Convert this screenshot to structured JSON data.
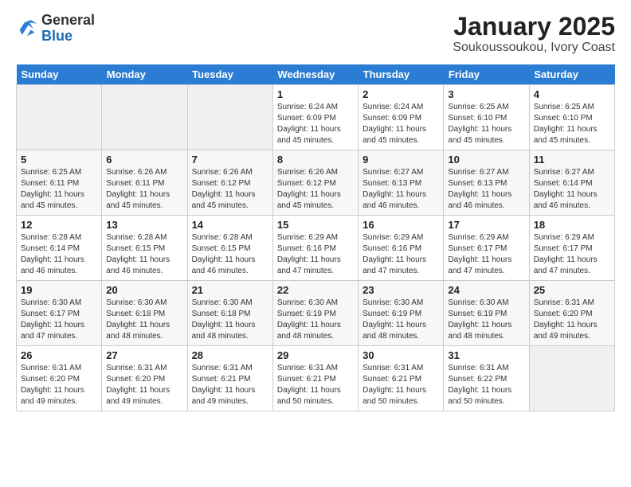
{
  "header": {
    "logo_general": "General",
    "logo_blue": "Blue",
    "title": "January 2025",
    "subtitle": "Soukoussoukou, Ivory Coast"
  },
  "columns": [
    "Sunday",
    "Monday",
    "Tuesday",
    "Wednesday",
    "Thursday",
    "Friday",
    "Saturday"
  ],
  "weeks": [
    [
      {
        "day": "",
        "sunrise": "",
        "sunset": "",
        "daylight": ""
      },
      {
        "day": "",
        "sunrise": "",
        "sunset": "",
        "daylight": ""
      },
      {
        "day": "",
        "sunrise": "",
        "sunset": "",
        "daylight": ""
      },
      {
        "day": "1",
        "sunrise": "Sunrise: 6:24 AM",
        "sunset": "Sunset: 6:09 PM",
        "daylight": "Daylight: 11 hours and 45 minutes."
      },
      {
        "day": "2",
        "sunrise": "Sunrise: 6:24 AM",
        "sunset": "Sunset: 6:09 PM",
        "daylight": "Daylight: 11 hours and 45 minutes."
      },
      {
        "day": "3",
        "sunrise": "Sunrise: 6:25 AM",
        "sunset": "Sunset: 6:10 PM",
        "daylight": "Daylight: 11 hours and 45 minutes."
      },
      {
        "day": "4",
        "sunrise": "Sunrise: 6:25 AM",
        "sunset": "Sunset: 6:10 PM",
        "daylight": "Daylight: 11 hours and 45 minutes."
      }
    ],
    [
      {
        "day": "5",
        "sunrise": "Sunrise: 6:25 AM",
        "sunset": "Sunset: 6:11 PM",
        "daylight": "Daylight: 11 hours and 45 minutes."
      },
      {
        "day": "6",
        "sunrise": "Sunrise: 6:26 AM",
        "sunset": "Sunset: 6:11 PM",
        "daylight": "Daylight: 11 hours and 45 minutes."
      },
      {
        "day": "7",
        "sunrise": "Sunrise: 6:26 AM",
        "sunset": "Sunset: 6:12 PM",
        "daylight": "Daylight: 11 hours and 45 minutes."
      },
      {
        "day": "8",
        "sunrise": "Sunrise: 6:26 AM",
        "sunset": "Sunset: 6:12 PM",
        "daylight": "Daylight: 11 hours and 45 minutes."
      },
      {
        "day": "9",
        "sunrise": "Sunrise: 6:27 AM",
        "sunset": "Sunset: 6:13 PM",
        "daylight": "Daylight: 11 hours and 46 minutes."
      },
      {
        "day": "10",
        "sunrise": "Sunrise: 6:27 AM",
        "sunset": "Sunset: 6:13 PM",
        "daylight": "Daylight: 11 hours and 46 minutes."
      },
      {
        "day": "11",
        "sunrise": "Sunrise: 6:27 AM",
        "sunset": "Sunset: 6:14 PM",
        "daylight": "Daylight: 11 hours and 46 minutes."
      }
    ],
    [
      {
        "day": "12",
        "sunrise": "Sunrise: 6:28 AM",
        "sunset": "Sunset: 6:14 PM",
        "daylight": "Daylight: 11 hours and 46 minutes."
      },
      {
        "day": "13",
        "sunrise": "Sunrise: 6:28 AM",
        "sunset": "Sunset: 6:15 PM",
        "daylight": "Daylight: 11 hours and 46 minutes."
      },
      {
        "day": "14",
        "sunrise": "Sunrise: 6:28 AM",
        "sunset": "Sunset: 6:15 PM",
        "daylight": "Daylight: 11 hours and 46 minutes."
      },
      {
        "day": "15",
        "sunrise": "Sunrise: 6:29 AM",
        "sunset": "Sunset: 6:16 PM",
        "daylight": "Daylight: 11 hours and 47 minutes."
      },
      {
        "day": "16",
        "sunrise": "Sunrise: 6:29 AM",
        "sunset": "Sunset: 6:16 PM",
        "daylight": "Daylight: 11 hours and 47 minutes."
      },
      {
        "day": "17",
        "sunrise": "Sunrise: 6:29 AM",
        "sunset": "Sunset: 6:17 PM",
        "daylight": "Daylight: 11 hours and 47 minutes."
      },
      {
        "day": "18",
        "sunrise": "Sunrise: 6:29 AM",
        "sunset": "Sunset: 6:17 PM",
        "daylight": "Daylight: 11 hours and 47 minutes."
      }
    ],
    [
      {
        "day": "19",
        "sunrise": "Sunrise: 6:30 AM",
        "sunset": "Sunset: 6:17 PM",
        "daylight": "Daylight: 11 hours and 47 minutes."
      },
      {
        "day": "20",
        "sunrise": "Sunrise: 6:30 AM",
        "sunset": "Sunset: 6:18 PM",
        "daylight": "Daylight: 11 hours and 48 minutes."
      },
      {
        "day": "21",
        "sunrise": "Sunrise: 6:30 AM",
        "sunset": "Sunset: 6:18 PM",
        "daylight": "Daylight: 11 hours and 48 minutes."
      },
      {
        "day": "22",
        "sunrise": "Sunrise: 6:30 AM",
        "sunset": "Sunset: 6:19 PM",
        "daylight": "Daylight: 11 hours and 48 minutes."
      },
      {
        "day": "23",
        "sunrise": "Sunrise: 6:30 AM",
        "sunset": "Sunset: 6:19 PM",
        "daylight": "Daylight: 11 hours and 48 minutes."
      },
      {
        "day": "24",
        "sunrise": "Sunrise: 6:30 AM",
        "sunset": "Sunset: 6:19 PM",
        "daylight": "Daylight: 11 hours and 48 minutes."
      },
      {
        "day": "25",
        "sunrise": "Sunrise: 6:31 AM",
        "sunset": "Sunset: 6:20 PM",
        "daylight": "Daylight: 11 hours and 49 minutes."
      }
    ],
    [
      {
        "day": "26",
        "sunrise": "Sunrise: 6:31 AM",
        "sunset": "Sunset: 6:20 PM",
        "daylight": "Daylight: 11 hours and 49 minutes."
      },
      {
        "day": "27",
        "sunrise": "Sunrise: 6:31 AM",
        "sunset": "Sunset: 6:20 PM",
        "daylight": "Daylight: 11 hours and 49 minutes."
      },
      {
        "day": "28",
        "sunrise": "Sunrise: 6:31 AM",
        "sunset": "Sunset: 6:21 PM",
        "daylight": "Daylight: 11 hours and 49 minutes."
      },
      {
        "day": "29",
        "sunrise": "Sunrise: 6:31 AM",
        "sunset": "Sunset: 6:21 PM",
        "daylight": "Daylight: 11 hours and 50 minutes."
      },
      {
        "day": "30",
        "sunrise": "Sunrise: 6:31 AM",
        "sunset": "Sunset: 6:21 PM",
        "daylight": "Daylight: 11 hours and 50 minutes."
      },
      {
        "day": "31",
        "sunrise": "Sunrise: 6:31 AM",
        "sunset": "Sunset: 6:22 PM",
        "daylight": "Daylight: 11 hours and 50 minutes."
      },
      {
        "day": "",
        "sunrise": "",
        "sunset": "",
        "daylight": ""
      }
    ]
  ]
}
